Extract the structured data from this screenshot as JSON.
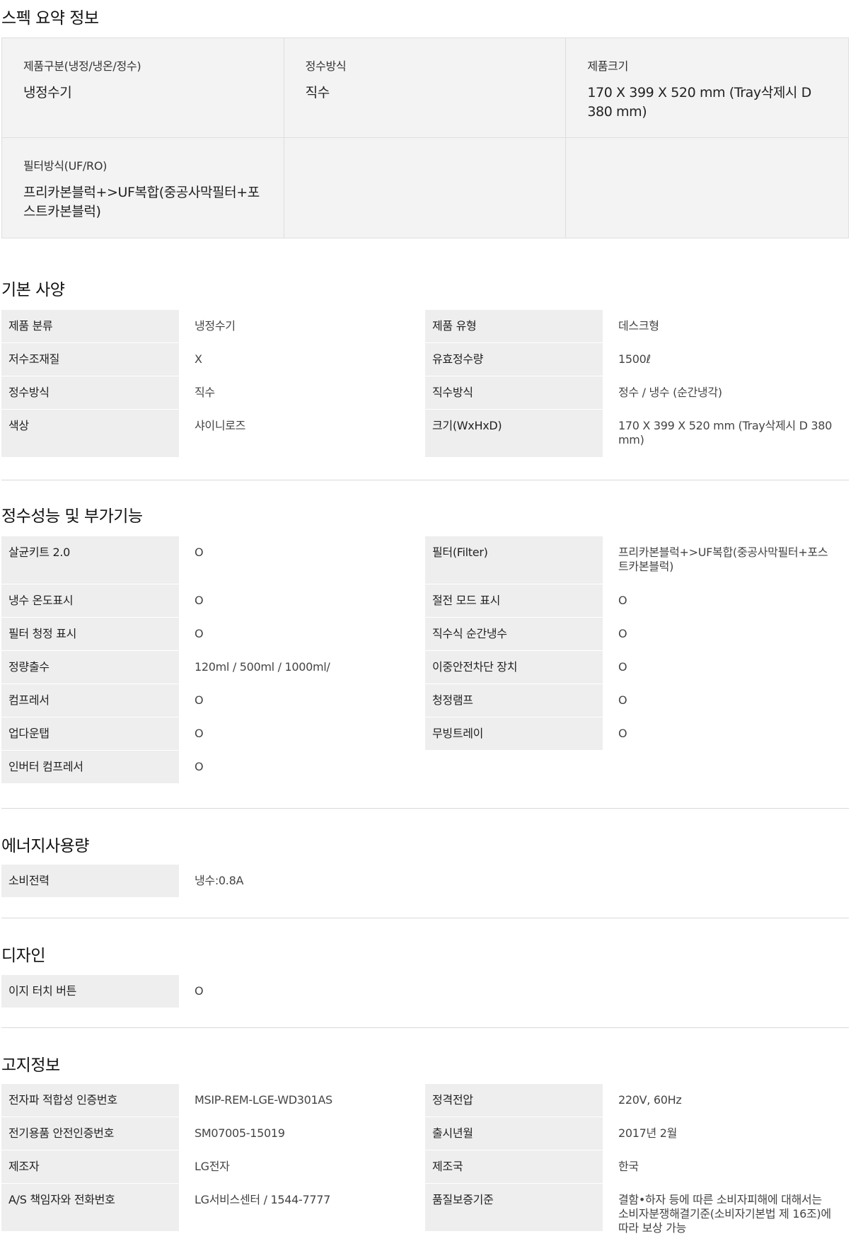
{
  "summary": {
    "title": "스펙 요약 정보",
    "cells": [
      {
        "label": "제품구분(냉정/냉온/정수)",
        "value": "냉정수기"
      },
      {
        "label": "정수방식",
        "value": "직수"
      },
      {
        "label": "제품크기",
        "value": "170 X 399 X 520 mm (Tray삭제시 D 380 mm)"
      },
      {
        "label": "필터방식(UF/RO)",
        "value": "프리카본블럭+>UF복합(중공사막필터+포스트카본블럭)"
      },
      {
        "label": "",
        "value": ""
      },
      {
        "label": "",
        "value": ""
      }
    ]
  },
  "basic": {
    "title": "기본 사양",
    "rows": [
      {
        "l1": "제품 분류",
        "v1": "냉정수기",
        "l2": "제품 유형",
        "v2": "데스크형"
      },
      {
        "l1": "저수조재질",
        "v1": "X",
        "l2": "유효정수량",
        "v2": "1500ℓ"
      },
      {
        "l1": "정수방식",
        "v1": "직수",
        "l2": "직수방식",
        "v2": "정수 / 냉수 (순간냉각)"
      },
      {
        "l1": "색상",
        "v1": "샤이니로즈",
        "l2": "크기(WxHxD)",
        "v2": "170 X 399 X 520 mm (Tray삭제시 D 380 mm)"
      }
    ]
  },
  "performance": {
    "title": "정수성능 및 부가기능",
    "rows": [
      {
        "l1": "살균키트 2.0",
        "v1": "O",
        "l2": "필터(Filter)",
        "v2": "프리카본블럭+>UF복합(중공사막필터+포스트카본블럭)"
      },
      {
        "l1": "냉수 온도표시",
        "v1": "O",
        "l2": "절전 모드 표시",
        "v2": "O"
      },
      {
        "l1": "필터 청정 표시",
        "v1": "O",
        "l2": "직수식 순간냉수",
        "v2": "O"
      },
      {
        "l1": "정량출수",
        "v1": "120ml / 500ml / 1000ml/",
        "l2": "이중안전차단 장치",
        "v2": "O"
      },
      {
        "l1": "컴프레서",
        "v1": "O",
        "l2": "청정램프",
        "v2": "O"
      },
      {
        "l1": "업다운탭",
        "v1": "O",
        "l2": "무빙트레이",
        "v2": "O"
      },
      {
        "l1": "인버터 컴프레서",
        "v1": "O",
        "l2": "",
        "v2": ""
      }
    ]
  },
  "energy": {
    "title": "에너지사용량",
    "rows": [
      {
        "l1": "소비전력",
        "v1": "냉수:0.8A"
      }
    ]
  },
  "design": {
    "title": "디자인",
    "rows": [
      {
        "l1": "이지 터치 버튼",
        "v1": "O"
      }
    ]
  },
  "notice": {
    "title": "고지정보",
    "rows": [
      {
        "l1": "전자파 적합성 인증번호",
        "v1": "MSIP-REM-LGE-WD301AS",
        "l2": "정격전압",
        "v2": "220V, 60Hz"
      },
      {
        "l1": "전기용품 안전인증번호",
        "v1": "SM07005-15019",
        "l2": "출시년월",
        "v2": "2017년 2월"
      },
      {
        "l1": "제조자",
        "v1": "LG전자",
        "l2": "제조국",
        "v2": "한국"
      },
      {
        "l1": "A/S 책임자와 전화번호",
        "v1": "LG서비스센터 / 1544-7777",
        "l2": "품질보증기준",
        "v2": "결함•하자 등에 따른 소비자피해에 대해서는 소비자분쟁해결기준(소비자기본법 제 16조)에 따라 보상 가능"
      }
    ]
  }
}
